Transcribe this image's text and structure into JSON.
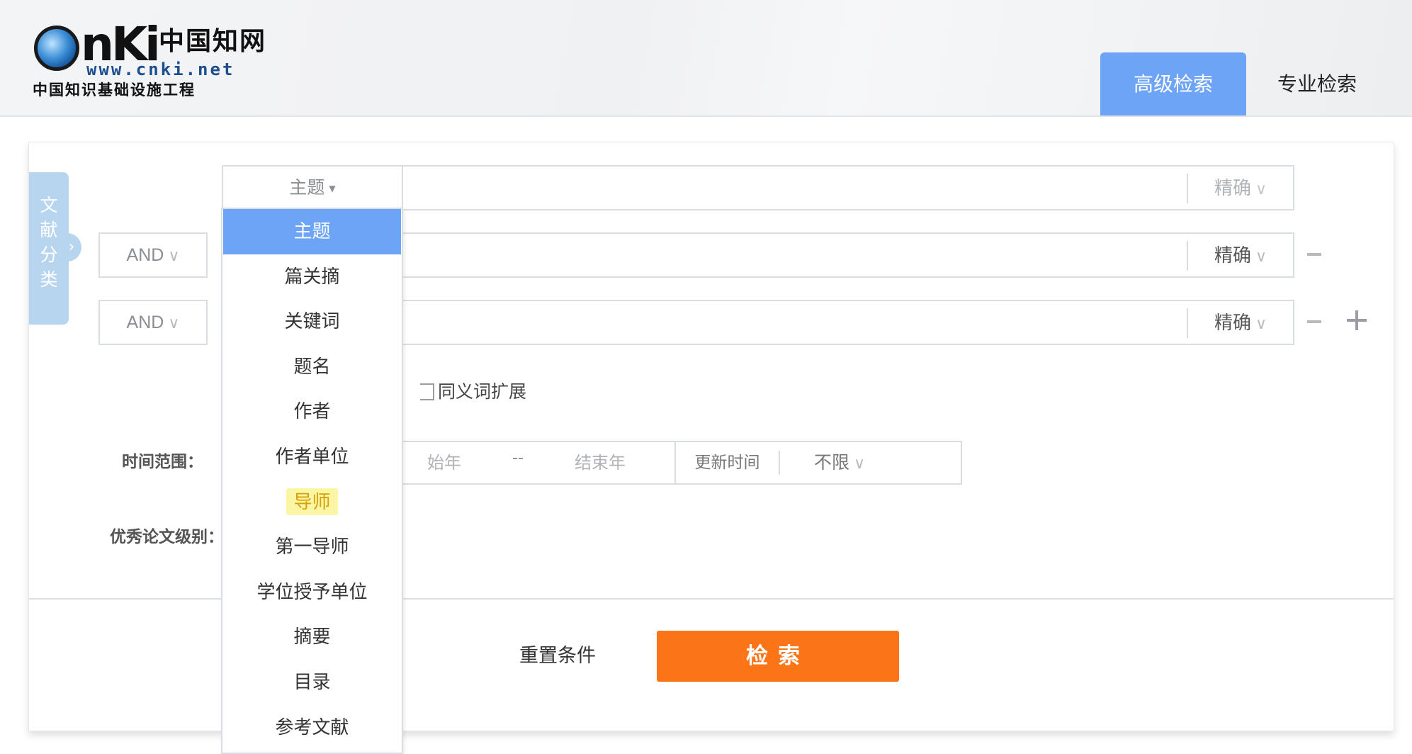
{
  "header": {
    "logo": {
      "brand": "CNKi",
      "brand_cn": "中国知网",
      "url": "www.cnki.net",
      "tagline": "中国知识基础设施工程"
    },
    "tabs": [
      {
        "label": "高级检索",
        "active": true
      },
      {
        "label": "专业检索",
        "active": false
      }
    ]
  },
  "side_tab": {
    "label_chars": [
      "文",
      "献",
      "分",
      "类"
    ],
    "arrow": "›"
  },
  "search_rows": [
    {
      "logic": "",
      "field": "主题",
      "value": "",
      "mode": "精确",
      "mode_chevron": "∨"
    },
    {
      "logic": "AND",
      "field": "",
      "value": "",
      "mode": "精确",
      "mode_chevron": "∨"
    },
    {
      "logic": "AND",
      "field": "",
      "value": "",
      "mode": "精确",
      "mode_chevron": "∨"
    }
  ],
  "logic_chevron": "∨",
  "synonym": {
    "label": "同义词扩展",
    "checked": false
  },
  "time_range": {
    "label": "时间范围：",
    "start_placeholder": "始年",
    "separator": "--",
    "end_placeholder": "结束年",
    "update_label": "更新时间",
    "update_value": "不限",
    "chevron": "∨"
  },
  "award_label": "优秀论文级别：",
  "actions": {
    "reset": "重置条件",
    "search": "检索"
  },
  "dropdown": {
    "items": [
      "主题",
      "篇关摘",
      "关键词",
      "题名",
      "作者",
      "作者单位",
      "导师",
      "第一导师",
      "学位授予单位",
      "摘要",
      "目录",
      "参考文献"
    ],
    "selected": "主题",
    "highlighted": "导师"
  },
  "colors": {
    "accent_blue": "#6ea4f6",
    "search_orange": "#fb7418",
    "side_tab_blue": "#b8d5ef",
    "highlight_yellow": "#fbf5a6"
  }
}
